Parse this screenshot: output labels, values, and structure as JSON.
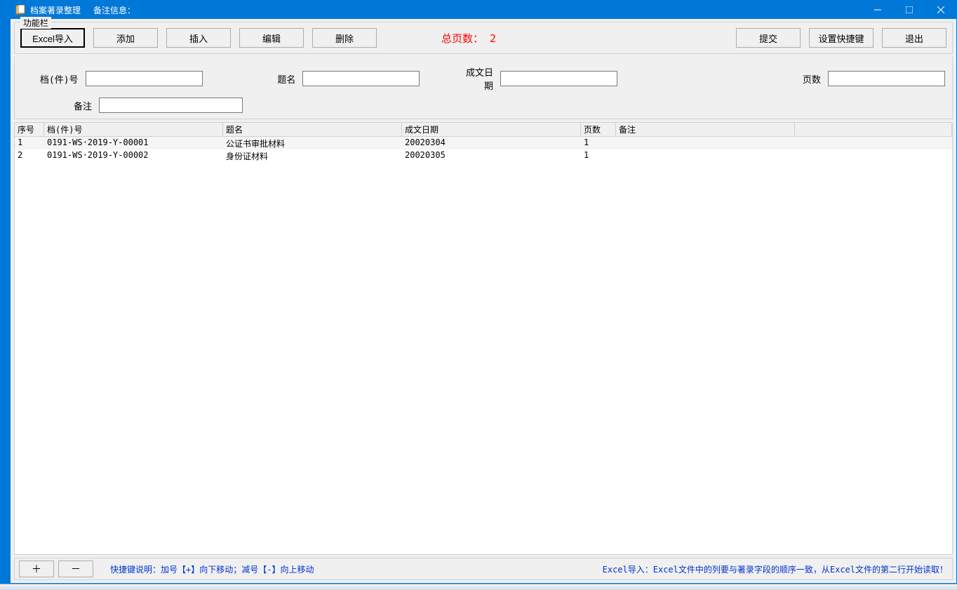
{
  "titlebar": {
    "title": "档案著录整理",
    "remark_label": "备注信息："
  },
  "groupbox": {
    "title": "功能栏",
    "btn_excel_import": "Excel导入",
    "btn_add": "添加",
    "btn_insert": "插入",
    "btn_edit": "编辑",
    "btn_delete": "删除",
    "btn_submit": "提交",
    "btn_shortcut": "设置快捷键",
    "btn_exit": "退出",
    "page_count_label": "总页数：",
    "page_count_value": "2"
  },
  "form": {
    "doc_no_label": "档(件)号",
    "doc_no_value": "",
    "title_label": "题名",
    "title_value": "",
    "date_label": "成文日期",
    "date_value": "",
    "pages_label": "页数",
    "pages_value": "",
    "remark_label": "备注",
    "remark_value": ""
  },
  "table": {
    "headers": {
      "seq": "序号",
      "doc": "档(件)号",
      "title": "题名",
      "date": "成文日期",
      "pages": "页数",
      "remark": "备注"
    },
    "rows": [
      {
        "seq": "1",
        "doc": "0191-WS·2019-Y-00001",
        "title": "公证书审批材料",
        "date": "20020304",
        "pages": "1",
        "remark": "",
        "selected": true
      },
      {
        "seq": "2",
        "doc": "0191-WS·2019-Y-00002",
        "title": "身份证材料",
        "date": "20020305",
        "pages": "1",
        "remark": "",
        "selected": false
      }
    ]
  },
  "footer": {
    "btn_plus": "＋",
    "btn_minus": "－",
    "hint_left": "快捷键说明：加号【+】向下移动；减号【-】向上移动",
    "hint_right": "Excel导入：Excel文件中的列要与著录字段的顺序一致，从Excel文件的第二行开始读取！"
  }
}
